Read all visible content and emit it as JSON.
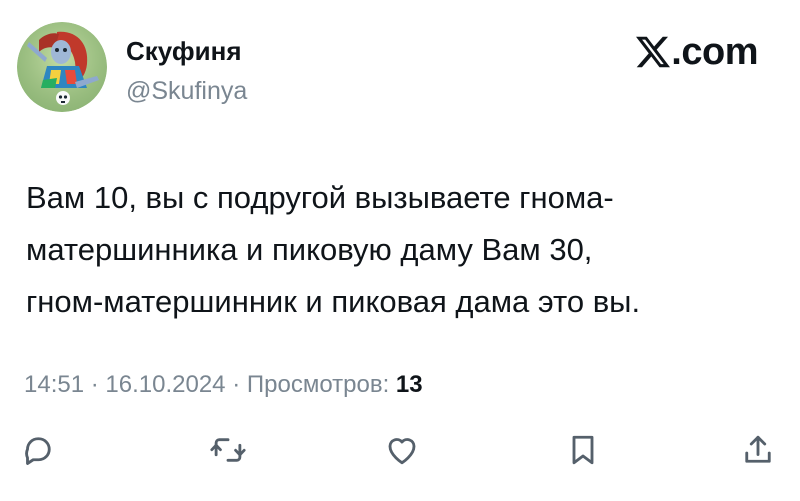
{
  "author": {
    "name": "Скуфиня",
    "handle": "@Skufinya"
  },
  "brand": {
    "label": ".com",
    "icon": "x-logo-icon"
  },
  "tweet": {
    "lines": [
      "Вам 10, вы с подругой вызываете гнома-",
      "матершинника и пиковую даму Вам 30,",
      "гном-матершинник и пиковая дама это вы."
    ]
  },
  "meta": {
    "time": "14:51",
    "separator": "·",
    "date": "16.10.2024",
    "views_label": "Просмотров:",
    "views_count": "13"
  },
  "actions": [
    {
      "name": "reply",
      "icon": "reply-icon"
    },
    {
      "name": "repost",
      "icon": "repost-icon"
    },
    {
      "name": "like",
      "icon": "heart-icon"
    },
    {
      "name": "bookmark",
      "icon": "bookmark-icon"
    },
    {
      "name": "share",
      "icon": "share-icon"
    }
  ],
  "colors": {
    "text": "#0f1419",
    "secondary": "#7a8691",
    "icon": "#55606b",
    "avatar_bg": "#a7c98e"
  }
}
